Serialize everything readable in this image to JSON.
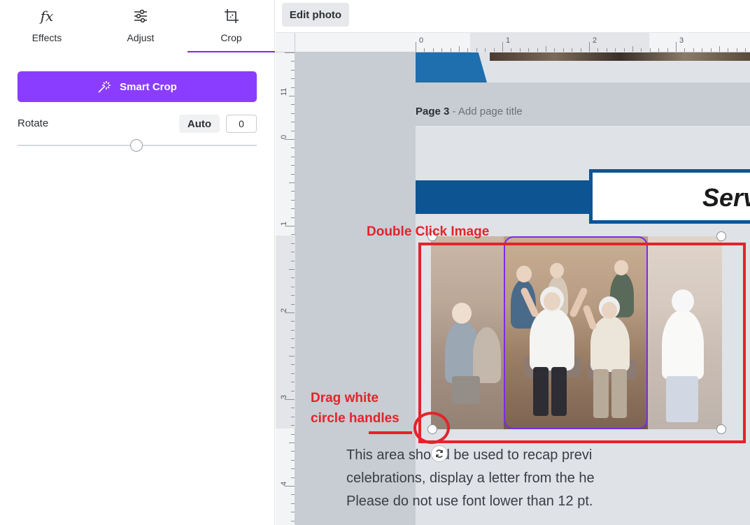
{
  "left_panel": {
    "tabs": [
      {
        "label": "Effects",
        "icon": "fx-icon"
      },
      {
        "label": "Adjust",
        "icon": "sliders-icon"
      },
      {
        "label": "Crop",
        "icon": "crop-icon"
      }
    ],
    "active_tab": "Crop",
    "fx_glyph": "fx",
    "smart_crop_label": "Smart Crop",
    "rotate": {
      "label": "Rotate",
      "auto_label": "Auto",
      "value": "0",
      "slider_value": 0
    }
  },
  "toolbar": {
    "edit_photo_label": "Edit photo"
  },
  "ruler": {
    "h_numbers": [
      "0",
      "1",
      "2",
      "3"
    ],
    "v_numbers": [
      "11",
      "0",
      "1",
      "2",
      "3",
      "4"
    ]
  },
  "canvas": {
    "page_number": "Page 3",
    "page_title_sep": " - ",
    "page_title_placeholder": "Add page title",
    "banner_text": "Serv",
    "body_lines": [
      "This area should be used to recap previ",
      "celebrations, display a letter from the he",
      "Please do not use font lower than 12 pt."
    ]
  },
  "annotations": {
    "double_click": "Double Click Image",
    "drag_line1": "Drag white",
    "drag_line2": "circle handles",
    "color": "#e4232b"
  },
  "colors": {
    "accent": "#8b3dff",
    "tab_underline": "#7d2ae8",
    "banner_blue": "#0d5493"
  }
}
